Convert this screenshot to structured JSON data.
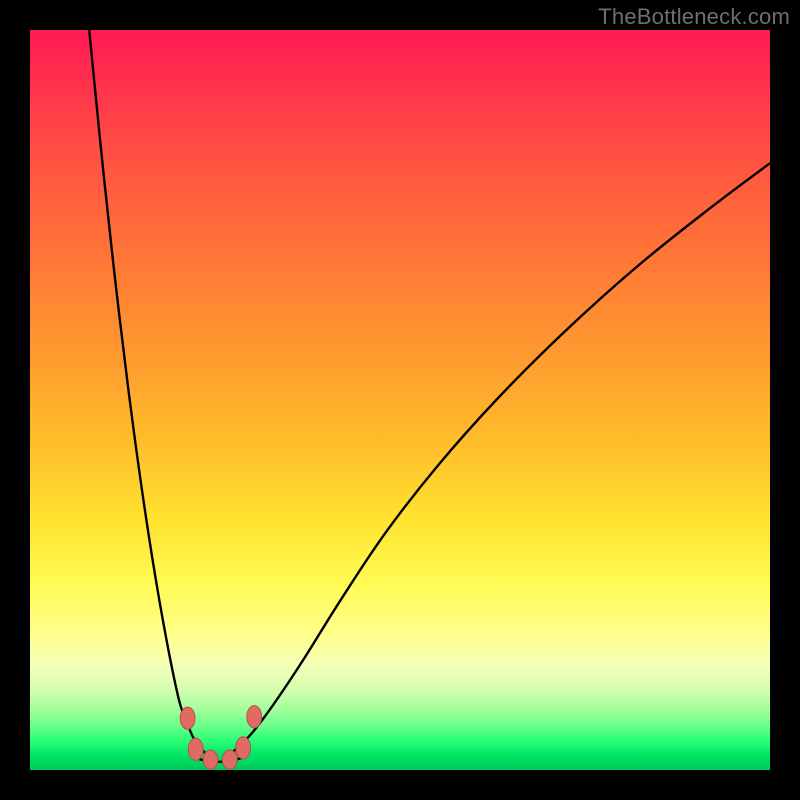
{
  "watermark": "TheBottleneck.com",
  "colors": {
    "frame": "#000000",
    "curve": "#000000",
    "marker_fill": "#e06b62",
    "marker_stroke": "#b85147",
    "gradient_top": "#ff1a53",
    "gradient_bottom": "#00c95a"
  },
  "chart_data": {
    "type": "line",
    "title": "",
    "xlabel": "",
    "ylabel": "",
    "xlim": [
      0,
      100
    ],
    "ylim": [
      0,
      100
    ],
    "grid": false,
    "series": [
      {
        "name": "bottleneck-curve-left",
        "x": [
          8,
          10,
          12,
          14,
          16,
          18,
          20,
          21,
          22,
          23,
          24
        ],
        "y": [
          100,
          80,
          62,
          46,
          32,
          20,
          10,
          7,
          4.5,
          3,
          2
        ]
      },
      {
        "name": "bottleneck-curve-right",
        "x": [
          27,
          28,
          30,
          33,
          37,
          42,
          48,
          55,
          63,
          72,
          82,
          92,
          100
        ],
        "y": [
          2,
          3,
          5,
          9,
          15,
          23,
          32,
          41,
          50,
          59,
          68,
          76,
          82
        ]
      },
      {
        "name": "valley-floor",
        "x": [
          22.5,
          24,
          25.5,
          27,
          28.5
        ],
        "y": [
          1.6,
          1.2,
          1.1,
          1.2,
          1.6
        ]
      }
    ],
    "markers": [
      {
        "x": 21.3,
        "y": 7.0,
        "rx": 1.0,
        "ry": 1.5
      },
      {
        "x": 22.4,
        "y": 2.8,
        "rx": 1.0,
        "ry": 1.5
      },
      {
        "x": 24.4,
        "y": 1.4,
        "rx": 1.0,
        "ry": 1.3
      },
      {
        "x": 27.0,
        "y": 1.4,
        "rx": 1.0,
        "ry": 1.3
      },
      {
        "x": 28.8,
        "y": 3.0,
        "rx": 1.0,
        "ry": 1.5
      },
      {
        "x": 30.3,
        "y": 7.2,
        "rx": 1.0,
        "ry": 1.5
      }
    ]
  }
}
